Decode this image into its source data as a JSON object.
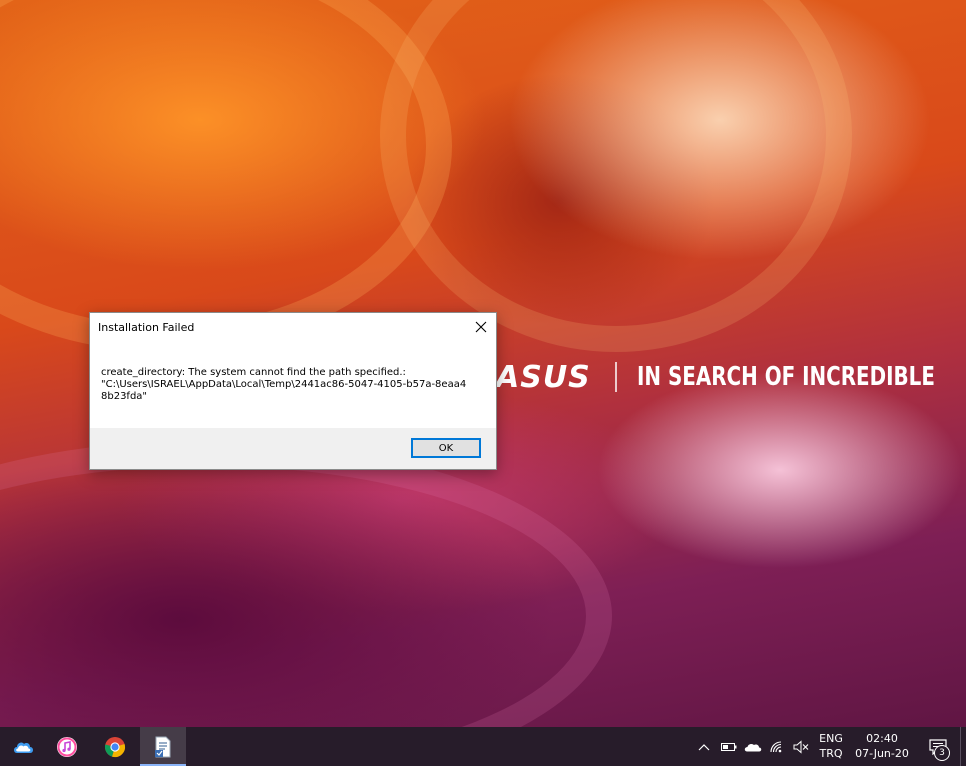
{
  "desktop": {
    "brand_logo": "ASUS",
    "brand_tagline": "IN SEARCH OF INCREDIBLE"
  },
  "dialog": {
    "title": "Installation Failed",
    "message_lines": [
      "create_directory: The system cannot find the path specified.:",
      "\"C:\\Users\\ISRAEL\\AppData\\Local\\Temp\\2441ac86-5047-4105-b57a-8eaa4",
      "8b23fda\""
    ],
    "ok_label": "OK",
    "close_icon": "close-icon"
  },
  "taskbar": {
    "apps": [
      {
        "name": "icloud-icon",
        "color": "#3d9bf0",
        "active": false
      },
      {
        "name": "itunes-icon",
        "color": "#ff4fa0",
        "active": false
      },
      {
        "name": "chrome-icon",
        "color": "#4285f4",
        "active": false
      },
      {
        "name": "installer-icon",
        "color": "#ffffff",
        "active": true
      }
    ],
    "tray": {
      "icons": [
        "chevron-up-icon",
        "battery-icon",
        "onedrive-icon",
        "wifi-icon",
        "volume-muted-icon"
      ],
      "language_line1": "ENG",
      "language_line2": "TRQ",
      "time": "02:40",
      "date": "07-Jun-20",
      "notification_count": "3"
    }
  }
}
